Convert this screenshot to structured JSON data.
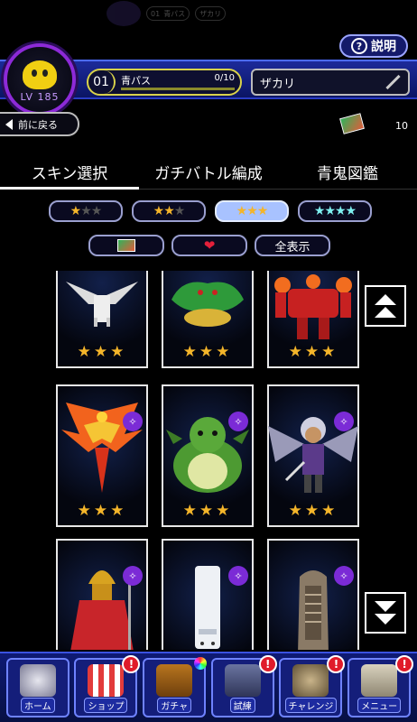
{
  "ghost_header": {
    "pass_num": "01",
    "pass_name": "青パス",
    "name": "ザカリ"
  },
  "help_label": "説明",
  "player": {
    "level": "LV 185",
    "pass_number": "01",
    "pass_name": "青パス",
    "pass_progress": "0/10",
    "pass_fraction": 0,
    "name": "ザカリ"
  },
  "back_label": "前に戻る",
  "ticket_count": "10",
  "tabs": [
    {
      "label": "スキン選択"
    },
    {
      "label": "ガチバトル編成"
    },
    {
      "label": "青鬼図鑑"
    }
  ],
  "star_filters": [
    {
      "stars": "★",
      "dim": "★★",
      "extra": ""
    },
    {
      "stars": "★★",
      "dim": "★",
      "extra": ""
    },
    {
      "stars": "★★★",
      "dim": "",
      "extra": ""
    },
    {
      "stars": "",
      "dim": "",
      "extra": "★★★★"
    }
  ],
  "type_filters": {
    "all_label": "全表示"
  },
  "cards": [
    {
      "name": "pegasus",
      "stars": "★★★",
      "badge": false
    },
    {
      "name": "dragon-green",
      "stars": "★★★",
      "badge": false
    },
    {
      "name": "red-robot",
      "stars": "★★★",
      "badge": false
    },
    {
      "name": "phoenix",
      "stars": "★★★",
      "badge": true
    },
    {
      "name": "green-dragon-fat",
      "stars": "★★★",
      "badge": true
    },
    {
      "name": "winged-warrior",
      "stars": "★★★",
      "badge": true
    },
    {
      "name": "red-mage",
      "stars": "",
      "badge": true
    },
    {
      "name": "white-tube",
      "stars": "",
      "badge": true
    },
    {
      "name": "ship",
      "stars": "",
      "badge": true
    }
  ],
  "nav": [
    {
      "label": "ホーム",
      "alert": ""
    },
    {
      "label": "ショップ",
      "alert": "!"
    },
    {
      "label": "ガチャ",
      "alert": ""
    },
    {
      "label": "試練",
      "alert": "!"
    },
    {
      "label": "チャレンジ",
      "alert": "!"
    },
    {
      "label": "メニュー",
      "alert": "!"
    }
  ]
}
